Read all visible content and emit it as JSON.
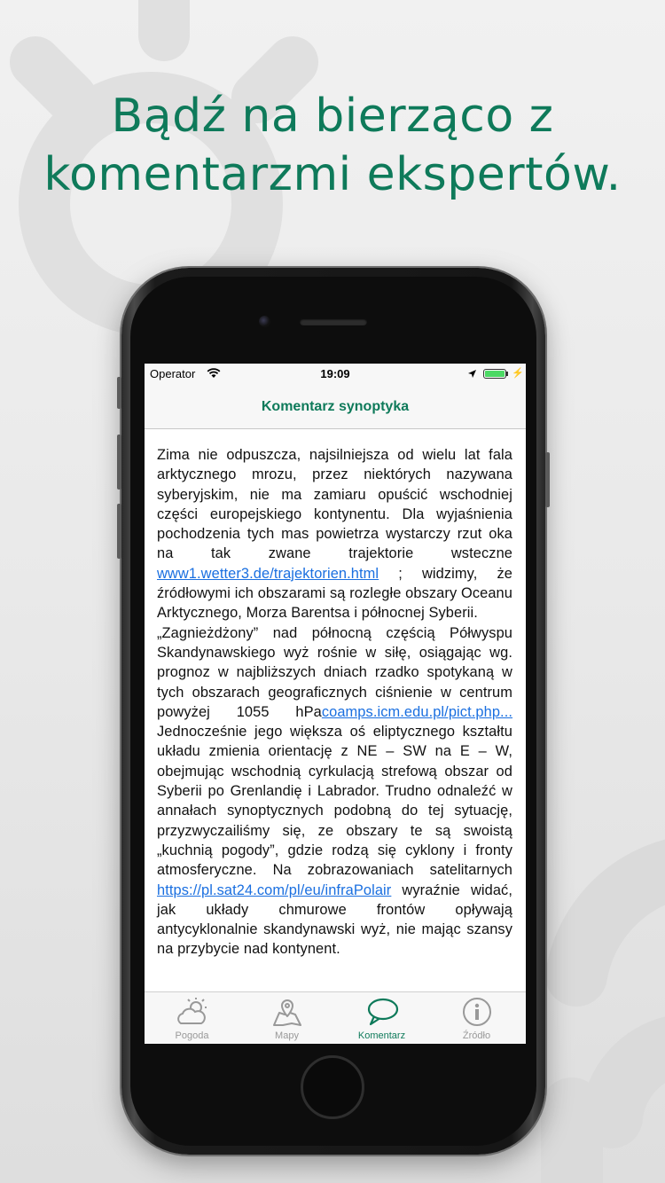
{
  "headline": {
    "line1": "Bądź na bierząco z",
    "line2": "komentarzmi ekspertów."
  },
  "status_bar": {
    "carrier": "Operator",
    "time": "19:09",
    "battery_level": 1.0
  },
  "nav": {
    "title": "Komentarz synoptyka"
  },
  "article": {
    "p1_a": "Zima nie odpuszcza, najsilniejsza od wielu lat fala arktycznego mrozu, przez niektórych nazywana syberyjskim, nie ma zamiaru opuścić wschodniej części europejskiego kontynentu. Dla wyjaśnienia pochodzenia tych mas powietrza wystarczy rzut oka na tak zwane trajektorie wsteczne ",
    "p1_link": "www1.wetter3.de/trajektorien.html",
    "p1_b": " ; widzimy, że źródłowymi ich obszarami są rozległe obszary Oceanu Arktycznego, Morza Barentsa i północnej Syberii.",
    "p2_a": "„Zagnieżdżony” nad północną częścią Półwyspu Skandynawskiego wyż rośnie w siłę, osiągając wg. prognoz w najbliższych dniach rzadko spotykaną w tych obszarach geograficznych ciśnienie w centrum powyżej 1055 hPa",
    "p2_link1": "coamps.icm.edu.pl/pict.php...",
    "p2_b": " Jednocześnie jego większa oś eliptycznego kształtu układu zmienia orientację z NE – SW na E – W, obejmując wschodnią cyrkulacją strefową obszar od Syberii po Grenlandię i Labrador. Trudno odnaleźć w annałach synoptycznych podobną do tej sytuację, przyzwyczailiśmy się, ze obszary te są swoistą „kuchnią pogody”, gdzie rodzą się cyklony i fronty atmosferyczne. Na zobrazowaniach satelitarnych ",
    "p2_link2": "https://pl.sat24.com/pl/eu/infraPolair",
    "p2_c": " wyraźnie widać, jak układy chmurowe frontów opływają antycyklonalnie skandynawski wyż, nie mając szansy na przybycie nad kontynent."
  },
  "tabs": [
    {
      "label": "Pogoda",
      "icon": "weather-icon",
      "active": false
    },
    {
      "label": "Mapy",
      "icon": "map-icon",
      "active": false
    },
    {
      "label": "Komentarz",
      "icon": "speech-bubble-icon",
      "active": true
    },
    {
      "label": "Źródło",
      "icon": "info-icon",
      "active": false
    }
  ],
  "colors": {
    "accent": "#0e7a5a",
    "link": "#1a6fe0",
    "tab_inactive": "#999999"
  }
}
